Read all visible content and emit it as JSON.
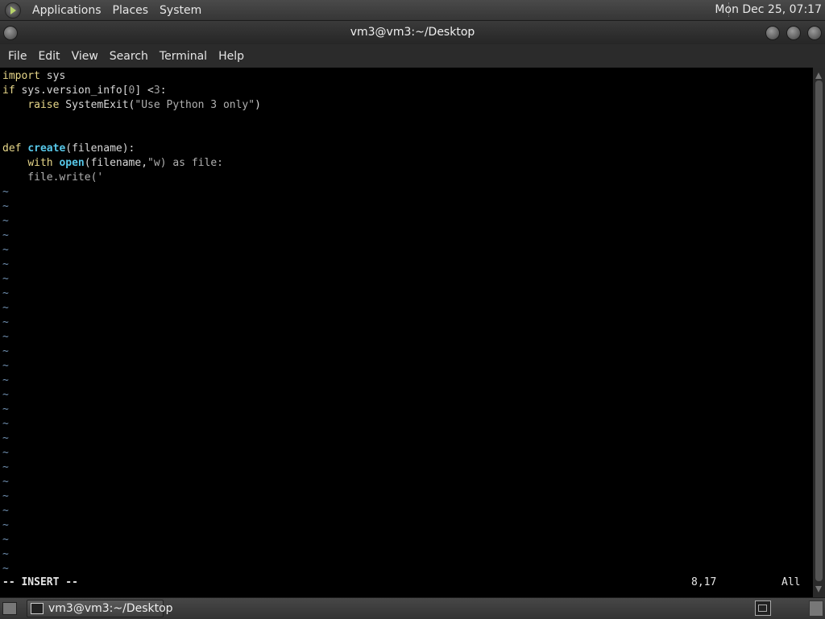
{
  "top_panel": {
    "applications": "Applications",
    "places": "Places",
    "system": "System",
    "clock": "Mon Dec 25, 07:17"
  },
  "window": {
    "title": "vm3@vm3:~/Desktop"
  },
  "menubar": {
    "file": "File",
    "edit": "Edit",
    "view": "View",
    "search": "Search",
    "terminal": "Terminal",
    "help": "Help"
  },
  "editor": {
    "l1_kw": "import",
    "l1_rest": " sys",
    "l2_kw": "if",
    "l2_a": " sys.version_info[",
    "l2_num": "0",
    "l2_b": "] <",
    "l2_num2": "3",
    "l2_c": ":",
    "l3_indent": "    ",
    "l3_kw": "raise",
    "l3_a": " SystemExit(",
    "l3_str": "\"Use Python 3 only\"",
    "l3_b": ")",
    "l6_kw": "def",
    "l6_fn": "create",
    "l6_rest": "(filename):",
    "l7_indent": "    ",
    "l7_kw": "with",
    "l7_fn": "open",
    "l7_a": "(filename,",
    "l7_str": "\"w) as file:",
    "l8_text": "    file.write('",
    "tilde": "~",
    "mode": "-- INSERT --",
    "position": "8,17",
    "scroll": "All"
  },
  "taskbar": {
    "task_label": "vm3@vm3:~/Desktop"
  }
}
